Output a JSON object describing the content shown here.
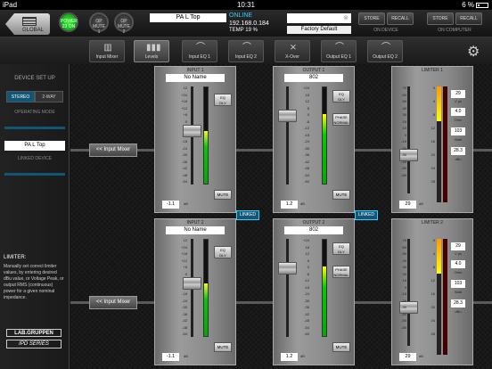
{
  "status": {
    "carrier": "iPad",
    "time": "10:31",
    "battery": "6 %"
  },
  "top": {
    "global": "GLOBAL",
    "power": "POWER\n23 ON",
    "mute1": "OP\nMUTE\n1",
    "mute2": "OP\nMUTE\n2",
    "preset": "PA L Top",
    "online": "ONLINE",
    "ip": "192.168.0.184",
    "temp": "TEMP 19 %",
    "factory": "Factory Default",
    "store": "STORE",
    "recall": "RECALL",
    "on_device": "ON DEVICE",
    "on_computer": "ON COMPUTER"
  },
  "tabs": [
    {
      "label": "Input Mixer"
    },
    {
      "label": "Levels"
    },
    {
      "label": "Input EQ 1"
    },
    {
      "label": "Input EQ 2"
    },
    {
      "label": "X-Over"
    },
    {
      "label": "Output EQ 1"
    },
    {
      "label": "Output EQ 2"
    }
  ],
  "sidebar": {
    "title": "DEVICE SET UP",
    "stereo": "STEREO",
    "two_way": "2-WAY",
    "op_mode": "OPERATING MODE",
    "linked_field": "PA L Top",
    "linked_device": "LINKED DEVICE",
    "limiter_title": "LIMITER:",
    "limiter_text": "Manually set correct limiter values, by entering desired dBu value, or Voltage Peak, or output RMS (continuous) power for a given nominal impedance.",
    "logo1": "LAB.GRUPPEN",
    "logo2": "IPD SERIES"
  },
  "labels": {
    "input_mixer": "<< Input Mixer",
    "linked": "LINKED",
    "eq": "EQ\nDLY",
    "phase": "PHASE\nNORMAL",
    "mute": "MUTE",
    "db": "dB",
    "v_pk": "V pk",
    "ohm": "Ohm",
    "watt": "Watt",
    "dbu": "dBu"
  },
  "scale_in": [
    "12",
    "+24",
    "+18",
    "+12",
    "+6",
    "0",
    "-6",
    "-12",
    "-18",
    "-24",
    "-30",
    "-36",
    "-42",
    "-48",
    "-54"
  ],
  "scale_meter": [
    "+24",
    "18",
    "12",
    "6",
    "0",
    "-6",
    "-12",
    "-18",
    "-24",
    "-30",
    "-36",
    "-42",
    "-48",
    "-54",
    "-60"
  ],
  "scale_lim": [
    "70",
    "60",
    "50",
    "40",
    "30",
    "20",
    "10",
    "0",
    "-10",
    "-20",
    "-30",
    "-40",
    "-50",
    "-60"
  ],
  "scale_gr": [
    "0",
    "4",
    "8",
    "12",
    "16",
    "20",
    "24",
    "28"
  ],
  "channels": [
    {
      "input": {
        "title": "INPUT 1",
        "name": "No Name",
        "value": "-1.1",
        "level": 0.55
      },
      "output": {
        "title": "OUTPUT 1",
        "name": "802",
        "value": "1.2",
        "level": 0.72
      },
      "limiter": {
        "title": "LIMITER 1",
        "value": "29",
        "dbu": "29",
        "vpk": "4.0",
        "ohm": "103",
        "watt": "28.3"
      }
    },
    {
      "input": {
        "title": "INPUT 2",
        "name": "No Name",
        "value": "-1.1",
        "level": 0.55
      },
      "output": {
        "title": "OUTPUT 2",
        "name": "802",
        "value": "1.2",
        "level": 0.72
      },
      "limiter": {
        "title": "LIMITER 2",
        "value": "29",
        "dbu": "29",
        "vpk": "4.0",
        "ohm": "103",
        "watt": "28.3"
      }
    }
  ]
}
